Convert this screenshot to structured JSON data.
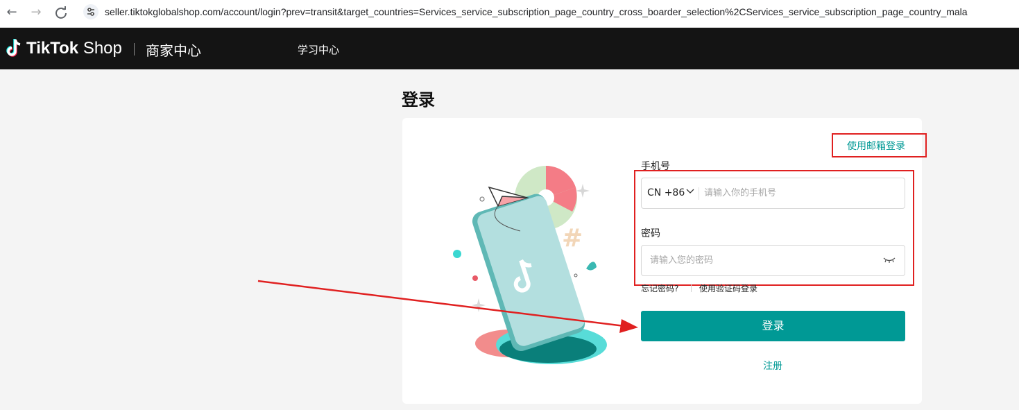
{
  "browser": {
    "url": "seller.tiktokglobalshop.com/account/login?prev=transit&target_countries=Services_service_subscription_page_country_cross_boarder_selection%2CServices_service_subscription_page_country_mala",
    "site_info_icon": "tune-icon"
  },
  "header": {
    "logo_brand": "TikTok",
    "logo_suffix": "Shop",
    "merchant_center": "商家中心",
    "learning_center": "学习中心"
  },
  "page": {
    "title": "登录"
  },
  "login_form": {
    "email_login_link": "使用邮箱登录",
    "phone_label": "手机号",
    "country_code": "CN +86",
    "phone_placeholder": "请输入你的手机号",
    "password_label": "密码",
    "password_placeholder": "请输入您的密码",
    "forgot_password": "忘记密码?",
    "code_login": "使用验证码登录",
    "submit_label": "登录",
    "register_label": "注册"
  },
  "colors": {
    "accent": "#009995",
    "header_bg": "#141414",
    "annotation_red": "#e02020"
  }
}
